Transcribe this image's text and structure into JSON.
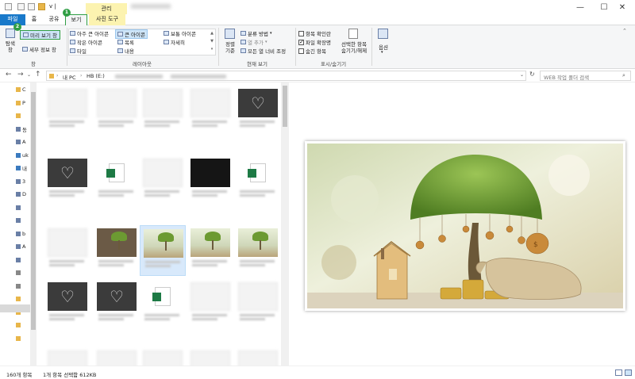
{
  "titlebar": {
    "path_hint": "v |",
    "minimize": "—",
    "maximize": "☐",
    "close": "✕"
  },
  "tabs": {
    "manage_header": "관리",
    "file": "파일",
    "home": "홈",
    "share": "공유",
    "view": "보기",
    "picture_tools": "사진 도구"
  },
  "badges": {
    "step1": "1",
    "step2": "2"
  },
  "ribbon": {
    "nav_pane": "탐색\n창",
    "preview_pane": "미리 보기 창",
    "details_pane": "세부 정보 창",
    "group_panes": "창",
    "layout": {
      "extra_large": "아주 큰 아이콘",
      "large": "큰 아이콘",
      "medium": "보통 아이콘",
      "small": "작은 아이콘",
      "list": "목록",
      "details": "자세히",
      "tiles": "타일",
      "content": "내용",
      "group_label": "레이아웃"
    },
    "current_view": {
      "sort": "정렬\n기준",
      "group_by": "분류 방법",
      "add_columns": "열 추가",
      "fit_columns": "모든 열 너비 조정",
      "group_label": "현재 보기"
    },
    "show_hide": {
      "item_checkbox": "항목 확인란",
      "file_ext": "파일 확장명",
      "hidden_items": "숨긴 항목",
      "hide_selected": "선택한 항목\n숨기기/해제",
      "group_label": "표시/숨기기"
    },
    "options": "옵션"
  },
  "address": {
    "path_pc": "내 PC",
    "path_drive": "HB (E:)",
    "search_placeholder": "WEB 작업 폴더 검색"
  },
  "nav_items": [
    "C",
    "P",
    "",
    "동",
    "A",
    "uk",
    "내",
    "3",
    "D",
    "",
    "",
    "b",
    "A",
    "",
    "",
    "",
    "",
    "",
    "",
    ""
  ],
  "status": {
    "item_count": "160개 항목",
    "selection": "1개 항목 선택함 612KB"
  },
  "colors": {
    "accent": "#1979ca",
    "manage_tab": "#fcf3b0",
    "highlight_box": "#2f9e44",
    "selected": "#d8e9fb"
  }
}
